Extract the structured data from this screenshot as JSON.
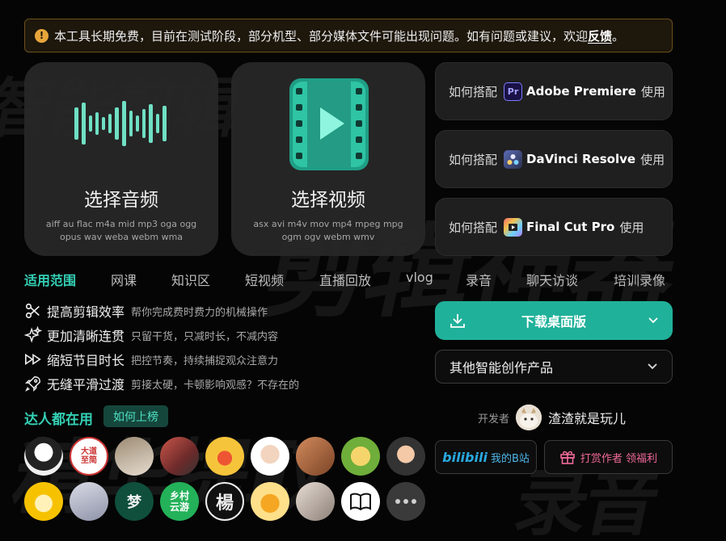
{
  "notice": {
    "text": "本工具长期免费，目前在测试阶段，部分机型、部分媒体文件可能出现问题。如有问题或建议，欢迎",
    "link": "反馈",
    "end": "。"
  },
  "audio_card": {
    "title": "选择音频",
    "formats": "aiff au flac m4a mid mp3 oga ogg opus wav weba webm wma"
  },
  "video_card": {
    "title": "选择视频",
    "formats": "asx avi m4v mov mp4 mpeg mpg ogm ogv webm wmv"
  },
  "howto": [
    {
      "prefix": "如何搭配",
      "app": "Adobe Premiere",
      "suffix": "使用",
      "icon": "premiere-icon",
      "badge": "Pr"
    },
    {
      "prefix": "如何搭配",
      "app": "DaVinci Resolve",
      "suffix": "使用",
      "icon": "davinci-icon"
    },
    {
      "prefix": "如何搭配",
      "app": "Final Cut Pro",
      "suffix": "使用",
      "icon": "finalcut-icon"
    }
  ],
  "tabs": [
    "适用范围",
    "网课",
    "知识区",
    "短视频",
    "直播回放",
    "vlog",
    "录音",
    "聊天访谈",
    "培训录像"
  ],
  "features": [
    {
      "title": "提高剪辑效率",
      "desc": "帮你完成费时费力的机械操作",
      "icon": "scissors-icon"
    },
    {
      "title": "更加清晰连贯",
      "desc": "只留干货，只减时长，不减内容",
      "icon": "sparkle-icon"
    },
    {
      "title": "缩短节目时长",
      "desc": "把控节奏，持续捕捉观众注意力",
      "icon": "fast-forward-icon"
    },
    {
      "title": "无缝平滑过渡",
      "desc": "剪接太硬，卡顿影响观感？不存在的",
      "icon": "rocket-icon"
    }
  ],
  "download_button": "下载桌面版",
  "other_products": "其他智能创作产品",
  "users": {
    "title": "达人都在用",
    "how_button": "如何上榜",
    "avatar_texts": [
      "大道至简",
      "梦",
      "乡村云游",
      "楊"
    ]
  },
  "developer": {
    "label": "开发者",
    "name": "渣渣就是玩儿"
  },
  "bili_button": {
    "logo": "bilibili",
    "label": "我的B站"
  },
  "reward_button": "打赏作者 领福利",
  "background_words": [
    "智能剪辑",
    "剪辑神器",
    "精华提取",
    "录音"
  ],
  "colors": {
    "accent": "#34d1b5",
    "download": "#20b19a",
    "notice_border": "#6b4f1c"
  }
}
